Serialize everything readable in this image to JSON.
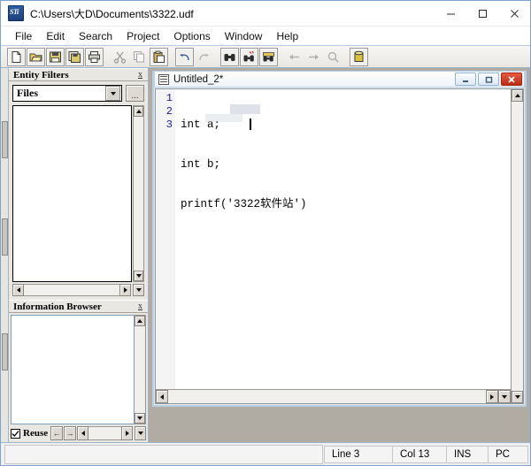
{
  "window": {
    "title": "C:\\Users\\大D\\Documents\\3322.udf",
    "icon": "sti-app-icon",
    "controls": {
      "minimize": "minimize-icon",
      "maximize": "maximize-icon",
      "close": "close-icon"
    }
  },
  "menubar": {
    "items": [
      {
        "label": "File"
      },
      {
        "label": "Edit"
      },
      {
        "label": "Search"
      },
      {
        "label": "Project"
      },
      {
        "label": "Options"
      },
      {
        "label": "Window"
      },
      {
        "label": "Help"
      }
    ]
  },
  "toolbar": {
    "groups": [
      {
        "buttons": [
          {
            "name": "new-file-button",
            "icon": "new-file-icon",
            "enabled": true
          },
          {
            "name": "open-file-button",
            "icon": "open-folder-icon",
            "enabled": true
          },
          {
            "name": "save-button",
            "icon": "floppy-disk-icon",
            "enabled": true
          },
          {
            "name": "save-all-button",
            "icon": "save-all-icon",
            "enabled": true
          },
          {
            "name": "print-button",
            "icon": "printer-icon",
            "enabled": true
          }
        ]
      },
      {
        "buttons": [
          {
            "name": "cut-button",
            "icon": "scissors-icon",
            "enabled": false
          },
          {
            "name": "copy-button",
            "icon": "copy-icon",
            "enabled": false
          },
          {
            "name": "paste-button",
            "icon": "clipboard-icon",
            "enabled": true
          }
        ]
      },
      {
        "buttons": [
          {
            "name": "undo-button",
            "icon": "undo-arrow-icon",
            "enabled": true
          },
          {
            "name": "redo-button",
            "icon": "redo-arrow-icon",
            "enabled": false
          }
        ]
      },
      {
        "buttons": [
          {
            "name": "find-button",
            "icon": "binoculars-icon",
            "enabled": true
          },
          {
            "name": "find-next-button",
            "icon": "binoculars-next-icon",
            "enabled": true
          },
          {
            "name": "find-in-files-button",
            "icon": "binoculars-file-icon",
            "enabled": true
          }
        ]
      },
      {
        "buttons": [
          {
            "name": "back-button",
            "icon": "arrow-left-icon",
            "enabled": false
          },
          {
            "name": "forward-button",
            "icon": "arrow-right-icon",
            "enabled": false
          },
          {
            "name": "zoom-button",
            "icon": "magnifier-icon",
            "enabled": false
          }
        ]
      },
      {
        "buttons": [
          {
            "name": "database-button",
            "icon": "database-barrel-icon",
            "enabled": true
          }
        ]
      }
    ]
  },
  "panels": {
    "entity_filters": {
      "title": "Entity Filters",
      "close_glyph": "x",
      "filter_select": {
        "value": "Files",
        "options": [
          "Files"
        ]
      },
      "browse_label": "...",
      "list_items": []
    },
    "information_browser": {
      "title": "Information Browser",
      "close_glyph": "x",
      "content": "",
      "reuse_label": "Reuse",
      "reuse_checked": true,
      "back_glyph": "←",
      "forward_glyph": "→"
    }
  },
  "editor": {
    "document_title": "Untitled_2*",
    "modified": true,
    "controls": {
      "minimize": "minimize-icon",
      "restore": "restore-icon",
      "close": "close-icon"
    },
    "lines": [
      {
        "number": "1",
        "text": "int a;"
      },
      {
        "number": "2",
        "text": "int b;"
      },
      {
        "number": "3",
        "text": "printf('3322软件站')"
      }
    ],
    "caret": {
      "line": 3,
      "col": 13
    }
  },
  "statusbar": {
    "cells": [
      {
        "name": "line-indicator",
        "text": "Line 3"
      },
      {
        "name": "column-indicator",
        "text": "Col 13"
      },
      {
        "name": "insert-mode-indicator",
        "text": "INS"
      },
      {
        "name": "platform-indicator",
        "text": "PC"
      }
    ]
  }
}
